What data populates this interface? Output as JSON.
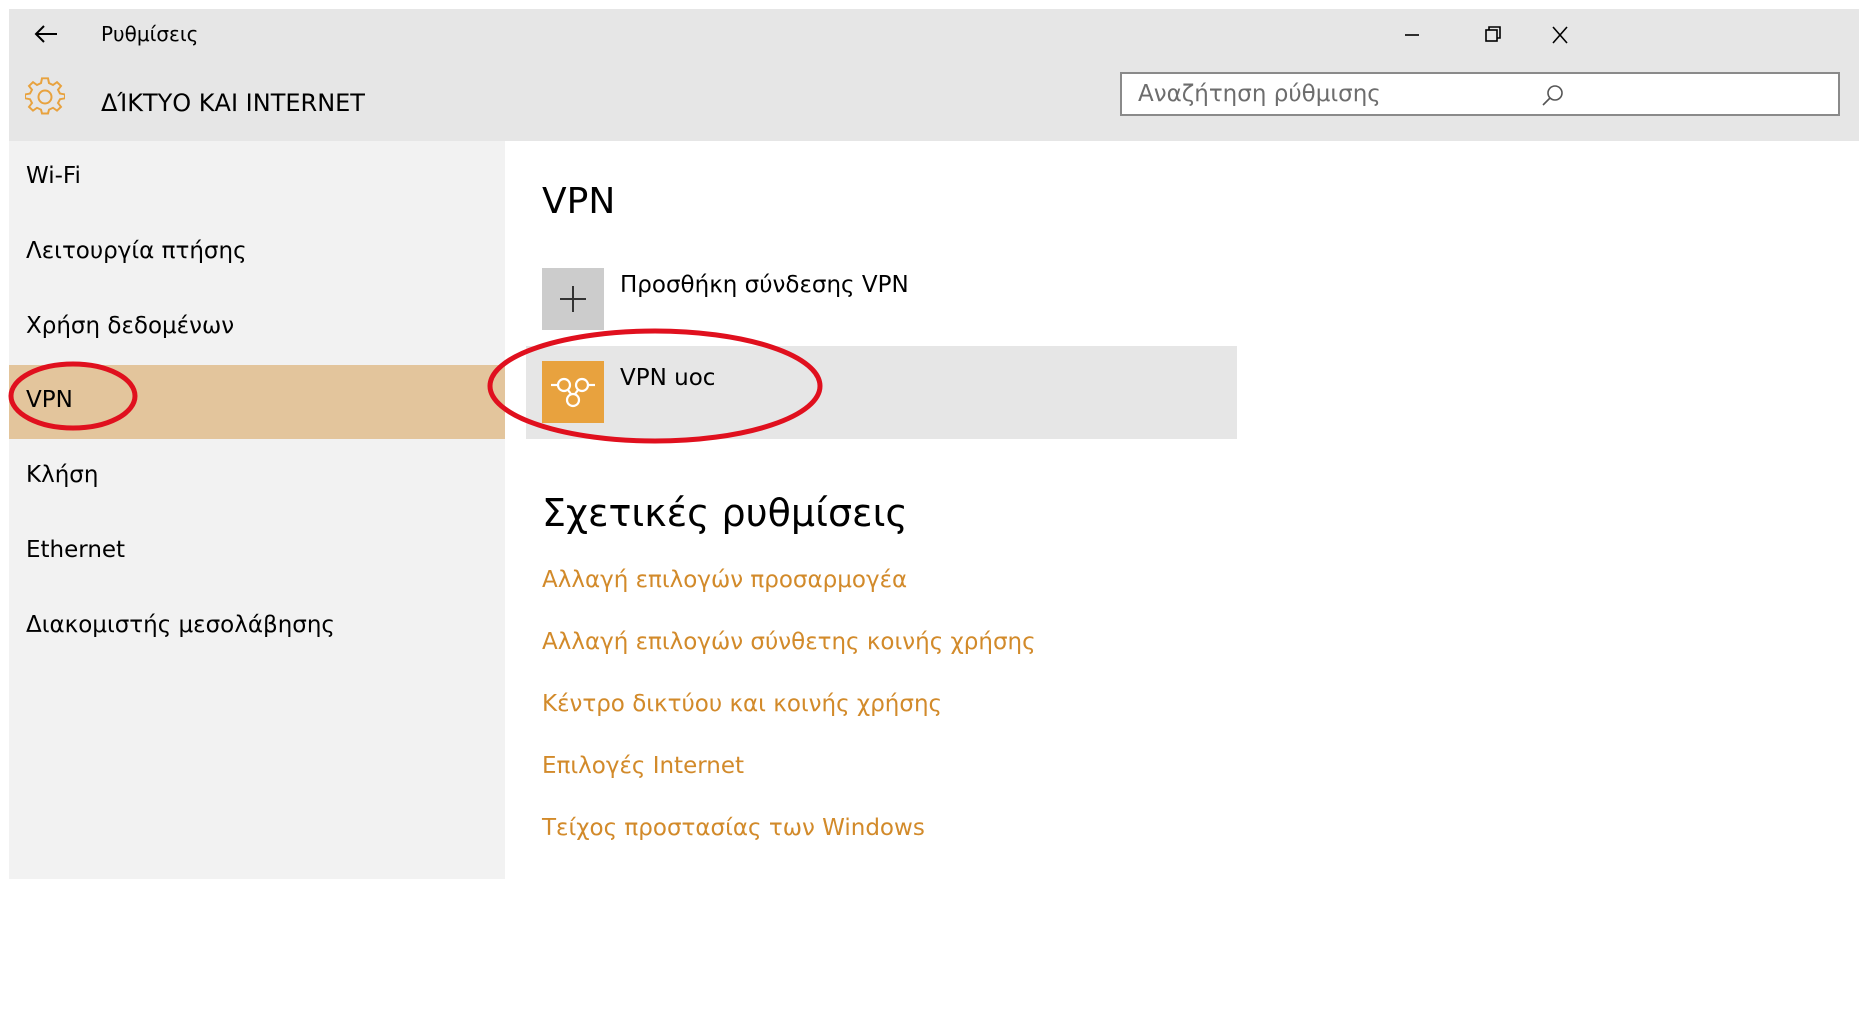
{
  "window": {
    "title": "Ρυθμίσεις",
    "back_icon": "back-arrow-icon",
    "controls": {
      "minimize_icon": "minimize-icon",
      "maximize_icon": "restore-icon",
      "close_icon": "close-icon"
    }
  },
  "header": {
    "icon": "gear-icon",
    "title": "ΔΊΚΤΥΟ ΚΑΙ INTERNET",
    "search_placeholder": "Αναζήτηση ρύθμισης",
    "search_icon": "search-icon"
  },
  "sidebar": {
    "items": [
      {
        "label": "Wi-Fi",
        "active": false
      },
      {
        "label": "Λειτουργία πτήσης",
        "active": false
      },
      {
        "label": "Χρήση δεδομένων",
        "active": false
      },
      {
        "label": "VPN",
        "active": true
      },
      {
        "label": "Κλήση",
        "active": false
      },
      {
        "label": "Ethernet",
        "active": false
      },
      {
        "label": "Διακομιστής μεσολάβησης",
        "active": false
      }
    ]
  },
  "main": {
    "heading": "VPN",
    "add_vpn_label": "Προσθήκη σύνδεσης VPN",
    "connections": [
      {
        "name": "VPN uoc",
        "icon": "vpn-connection-icon"
      }
    ],
    "related_heading": "Σχετικές ρυθμίσεις",
    "related_links": [
      "Αλλαγή επιλογών προσαρμογέα",
      "Αλλαγή επιλογών σύνθετης κοινής χρήσης",
      "Κέντρο δικτύου και κοινής χρήσης",
      "Επιλογές Internet",
      "Τείχος προστασίας των Windows"
    ]
  },
  "colors": {
    "accent": "#e8a23e",
    "link": "#d28a2a",
    "sidebar_active": "#e3c59c",
    "annotation": "#e0101e"
  }
}
